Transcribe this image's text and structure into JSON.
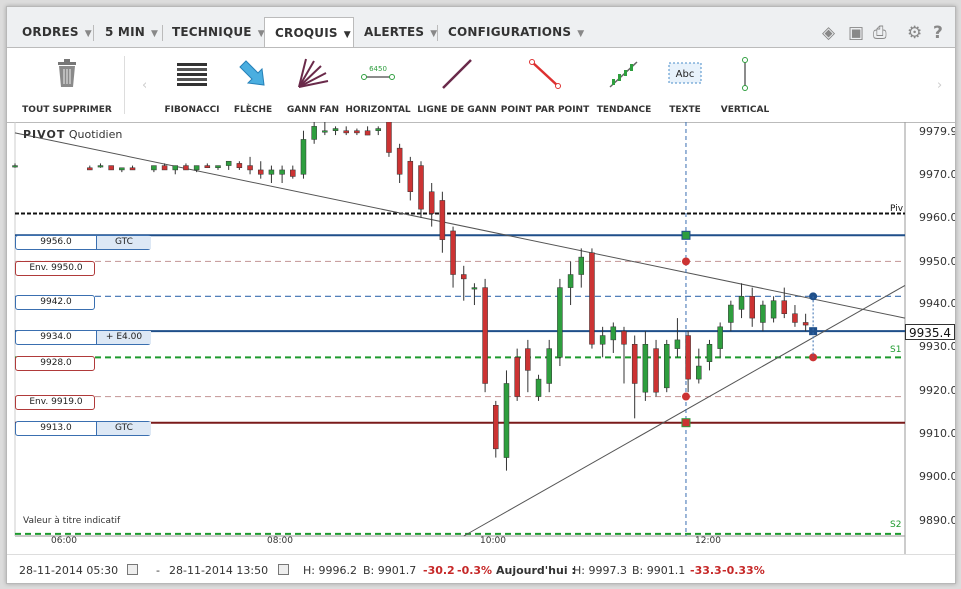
{
  "tabs": [
    {
      "label": "ORDRES",
      "dropdown": true
    },
    {
      "label": "5 MIN",
      "dropdown": true
    },
    {
      "label": "TECHNIQUE",
      "dropdown": true
    },
    {
      "label": "CROQUIS",
      "dropdown": true,
      "active": true
    },
    {
      "label": "ALERTES",
      "dropdown": true
    },
    {
      "label": "CONFIGURATIONS",
      "dropdown": true
    }
  ],
  "header_icons": [
    "layers-icon",
    "image-icon",
    "print-icon",
    "gear-icon",
    "help-icon"
  ],
  "header_icon_glyphs": {
    "layers": "◈",
    "image": "▣",
    "print": "⎙",
    "gear": "⚙",
    "help": "?"
  },
  "toolbar": {
    "delete_all": "TOUT SUPPRIMER",
    "tools": [
      "FIBONACCI",
      "FLÈCHE",
      "GANN FAN",
      "HORIZONTAL",
      "LIGNE DE GANN",
      "POINT PAR POINT",
      "TENDANCE",
      "TEXTE",
      "VERTICAL"
    ],
    "horizontal_sample": "6450",
    "text_sample": "Abc",
    "nav_prev": "‹",
    "nav_next": "›"
  },
  "chart": {
    "instrument": "PIVOT",
    "period": "Quotidien",
    "disclaimer": "Valeur à titre indicatif",
    "y_ticks": [
      "9979.9",
      "9970.0",
      "9960.0",
      "9950.0",
      "9940.0",
      "9930.0",
      "9920.0",
      "9910.0",
      "9900.0",
      "9890.0"
    ],
    "x_ticks": [
      "06:00",
      "08:00",
      "10:00",
      "12:00"
    ],
    "last_price": "9935.4",
    "levels": {
      "piv": "Piv",
      "s1": "S1",
      "s2": "S2"
    },
    "orders": [
      {
        "price": "9956.0",
        "side": "GTC",
        "color": "blue"
      },
      {
        "price": "Env. 9950.0",
        "side": "",
        "color": "red"
      },
      {
        "price": "9942.0",
        "side": "",
        "color": "blue"
      },
      {
        "price": "9934.0",
        "side": "+ E4.00",
        "color": "blue"
      },
      {
        "price": "9928.0",
        "side": "",
        "color": "red"
      },
      {
        "price": "Env. 9919.0",
        "side": "",
        "color": "red"
      },
      {
        "price": "9913.0",
        "side": "GTC",
        "color": "blue"
      }
    ],
    "colors": {
      "up": "#2e9e3e",
      "down": "#cc3333",
      "blue_line": "#1f4f8a",
      "red_line": "#7a1a1a",
      "green_dash": "#1e9a2e"
    }
  },
  "chart_data": {
    "type": "candlestick",
    "y_range": [
      9887,
      9982
    ],
    "x_range_hours": [
      5.5,
      13.83
    ],
    "series": [
      {
        "t": 5.5,
        "o": 9972,
        "h": 9972.5,
        "l": 9971.5,
        "c": 9972
      },
      {
        "t": 6.2,
        "o": 9971.5,
        "h": 9972,
        "l": 9971,
        "c": 9971
      },
      {
        "t": 6.3,
        "o": 9972,
        "h": 9972.5,
        "l": 9971.5,
        "c": 9972
      },
      {
        "t": 6.4,
        "o": 9972,
        "h": 9972,
        "l": 9971,
        "c": 9971
      },
      {
        "t": 6.5,
        "o": 9971,
        "h": 9971.5,
        "l": 9970.5,
        "c": 9971.5
      },
      {
        "t": 6.6,
        "o": 9971.5,
        "h": 9972,
        "l": 9971,
        "c": 9971
      },
      {
        "t": 6.8,
        "o": 9971,
        "h": 9972,
        "l": 9970.5,
        "c": 9972
      },
      {
        "t": 6.9,
        "o": 9972,
        "h": 9972.5,
        "l": 9971,
        "c": 9971
      },
      {
        "t": 7.0,
        "o": 9971,
        "h": 9972,
        "l": 9970,
        "c": 9972
      },
      {
        "t": 7.1,
        "o": 9972,
        "h": 9972.5,
        "l": 9971,
        "c": 9971
      },
      {
        "t": 7.2,
        "o": 9971,
        "h": 9972,
        "l": 9970.5,
        "c": 9972
      },
      {
        "t": 7.3,
        "o": 9972,
        "h": 9972.5,
        "l": 9971.5,
        "c": 9971.5
      },
      {
        "t": 7.4,
        "o": 9971.5,
        "h": 9972,
        "l": 9971,
        "c": 9972
      },
      {
        "t": 7.5,
        "o": 9972,
        "h": 9973,
        "l": 9971,
        "c": 9973
      },
      {
        "t": 7.6,
        "o": 9972.5,
        "h": 9973,
        "l": 9971,
        "c": 9971.5
      },
      {
        "t": 7.7,
        "o": 9972,
        "h": 9974,
        "l": 9970,
        "c": 9971
      },
      {
        "t": 7.8,
        "o": 9971,
        "h": 9973,
        "l": 9969,
        "c": 9970
      },
      {
        "t": 7.9,
        "o": 9970,
        "h": 9972,
        "l": 9968,
        "c": 9971
      },
      {
        "t": 8.0,
        "o": 9970,
        "h": 9972,
        "l": 9968,
        "c": 9971
      },
      {
        "t": 8.1,
        "o": 9971,
        "h": 9972,
        "l": 9969,
        "c": 9969.5
      },
      {
        "t": 8.2,
        "o": 9970,
        "h": 9980,
        "l": 9969,
        "c": 9978
      },
      {
        "t": 8.3,
        "o": 9978,
        "h": 9982,
        "l": 9977,
        "c": 9981
      },
      {
        "t": 8.4,
        "o": 9980,
        "h": 9982,
        "l": 9979,
        "c": 9980
      },
      {
        "t": 8.5,
        "o": 9980,
        "h": 9981,
        "l": 9979,
        "c": 9980.5
      },
      {
        "t": 8.6,
        "o": 9980,
        "h": 9981,
        "l": 9979,
        "c": 9979.5
      },
      {
        "t": 8.7,
        "o": 9980,
        "h": 9980.5,
        "l": 9979,
        "c": 9979.5
      },
      {
        "t": 8.8,
        "o": 9980,
        "h": 9981,
        "l": 9979,
        "c": 9979
      },
      {
        "t": 8.9,
        "o": 9980,
        "h": 9981,
        "l": 9979,
        "c": 9980.5
      },
      {
        "t": 9.0,
        "o": 9982,
        "h": 9982,
        "l": 9974,
        "c": 9975
      },
      {
        "t": 9.1,
        "o": 9976,
        "h": 9977,
        "l": 9968,
        "c": 9970
      },
      {
        "t": 9.2,
        "o": 9973,
        "h": 9974,
        "l": 9964,
        "c": 9966
      },
      {
        "t": 9.3,
        "o": 9972,
        "h": 9973,
        "l": 9960,
        "c": 9962
      },
      {
        "t": 9.4,
        "o": 9966,
        "h": 9968,
        "l": 9958,
        "c": 9961
      },
      {
        "t": 9.5,
        "o": 9964,
        "h": 9966,
        "l": 9952,
        "c": 9955
      },
      {
        "t": 9.6,
        "o": 9957,
        "h": 9958,
        "l": 9944,
        "c": 9947
      },
      {
        "t": 9.7,
        "o": 9947,
        "h": 9949,
        "l": 9941,
        "c": 9946
      },
      {
        "t": 9.8,
        "o": 9944,
        "h": 9945,
        "l": 9940,
        "c": 9944
      },
      {
        "t": 9.9,
        "o": 9944,
        "h": 9946,
        "l": 9920,
        "c": 9922
      },
      {
        "t": 10.0,
        "o": 9917,
        "h": 9918,
        "l": 9905,
        "c": 9907
      },
      {
        "t": 10.1,
        "o": 9905,
        "h": 9925,
        "l": 9902,
        "c": 9922
      },
      {
        "t": 10.2,
        "o": 9928,
        "h": 9930,
        "l": 9918,
        "c": 9919
      },
      {
        "t": 10.3,
        "o": 9930,
        "h": 9932,
        "l": 9920,
        "c": 9925
      },
      {
        "t": 10.4,
        "o": 9919,
        "h": 9924,
        "l": 9918,
        "c": 9923
      },
      {
        "t": 10.5,
        "o": 9922,
        "h": 9932,
        "l": 9920,
        "c": 9930
      },
      {
        "t": 10.6,
        "o": 9928,
        "h": 9946,
        "l": 9926,
        "c": 9944
      },
      {
        "t": 10.7,
        "o": 9944,
        "h": 9950,
        "l": 9940,
        "c": 9947
      },
      {
        "t": 10.8,
        "o": 9947,
        "h": 9953,
        "l": 9944,
        "c": 9951
      },
      {
        "t": 10.9,
        "o": 9952,
        "h": 9953,
        "l": 9930,
        "c": 9931
      },
      {
        "t": 11.0,
        "o": 9931,
        "h": 9935,
        "l": 9928,
        "c": 9933
      },
      {
        "t": 11.1,
        "o": 9932,
        "h": 9936,
        "l": 9929,
        "c": 9935
      },
      {
        "t": 11.2,
        "o": 9934,
        "h": 9935,
        "l": 9922,
        "c": 9931
      },
      {
        "t": 11.3,
        "o": 9931,
        "h": 9933,
        "l": 9914,
        "c": 9922
      },
      {
        "t": 11.4,
        "o": 9920,
        "h": 9934,
        "l": 9918,
        "c": 9931
      },
      {
        "t": 11.5,
        "o": 9930,
        "h": 9932,
        "l": 9919,
        "c": 9920
      },
      {
        "t": 11.6,
        "o": 9921,
        "h": 9932,
        "l": 9920,
        "c": 9931
      },
      {
        "t": 11.7,
        "o": 9930,
        "h": 9937,
        "l": 9928,
        "c": 9932
      },
      {
        "t": 11.8,
        "o": 9933,
        "h": 9934,
        "l": 9920,
        "c": 9923
      },
      {
        "t": 11.9,
        "o": 9923,
        "h": 9930,
        "l": 9922,
        "c": 9926
      },
      {
        "t": 12.0,
        "o": 9927,
        "h": 9932,
        "l": 9925,
        "c": 9931
      },
      {
        "t": 12.1,
        "o": 9930,
        "h": 9936,
        "l": 9928,
        "c": 9935
      },
      {
        "t": 12.2,
        "o": 9936,
        "h": 9941,
        "l": 9934,
        "c": 9940
      },
      {
        "t": 12.3,
        "o": 9939,
        "h": 9945,
        "l": 9937,
        "c": 9942
      },
      {
        "t": 12.4,
        "o": 9942,
        "h": 9944,
        "l": 9935,
        "c": 9937
      },
      {
        "t": 12.5,
        "o": 9936,
        "h": 9941,
        "l": 9934,
        "c": 9940
      },
      {
        "t": 12.6,
        "o": 9937,
        "h": 9942,
        "l": 9936,
        "c": 9941
      },
      {
        "t": 12.7,
        "o": 9941,
        "h": 9944,
        "l": 9937,
        "c": 9938
      },
      {
        "t": 12.8,
        "o": 9938,
        "h": 9940,
        "l": 9935,
        "c": 9936
      },
      {
        "t": 12.9,
        "o": 9936,
        "h": 9938,
        "l": 9934,
        "c": 9935.4
      }
    ],
    "horizontal_lines": [
      {
        "y": 9961,
        "style": "dashed",
        "color": "#111",
        "label": "Piv"
      },
      {
        "y": 9956,
        "style": "solid",
        "color": "#1f4f8a"
      },
      {
        "y": 9950,
        "style": "dashed",
        "color": "#c9a0a0"
      },
      {
        "y": 9942,
        "style": "dashed",
        "color": "#3a6fb0"
      },
      {
        "y": 9934,
        "style": "solid",
        "color": "#1f4f8a"
      },
      {
        "y": 9928,
        "style": "dashed",
        "color": "#1e9a2e",
        "label": "S1"
      },
      {
        "y": 9919,
        "style": "dashed",
        "color": "#c9a0a0"
      },
      {
        "y": 9913,
        "style": "solid",
        "color": "#7a1a1a"
      },
      {
        "y": 9887.5,
        "style": "dashed",
        "color": "#1e9a2e",
        "label": "S2"
      }
    ],
    "trend_lines": [
      {
        "from": {
          "t": 5.5,
          "y": 9979.5
        },
        "to": {
          "t": 13.83,
          "y": 9937
        }
      },
      {
        "from": {
          "t": 9.7,
          "y": 9887
        },
        "to": {
          "t": 13.83,
          "y": 9944.5
        }
      }
    ],
    "vertical_line": {
      "t": 11.78
    }
  },
  "status": {
    "from_date": "28-11-2014 05:30",
    "separator": "-",
    "to_date": "28-11-2014 13:50",
    "high": "H: 9996.2",
    "low": "B: 9901.7",
    "change": "-30.2",
    "change_pct": "-0.3%",
    "today_label": "Aujourd'hui :",
    "today_high": "H: 9997.3",
    "today_low": "B: 9901.1",
    "today_change": "-33.3",
    "today_change_pct": "-0.33%"
  }
}
